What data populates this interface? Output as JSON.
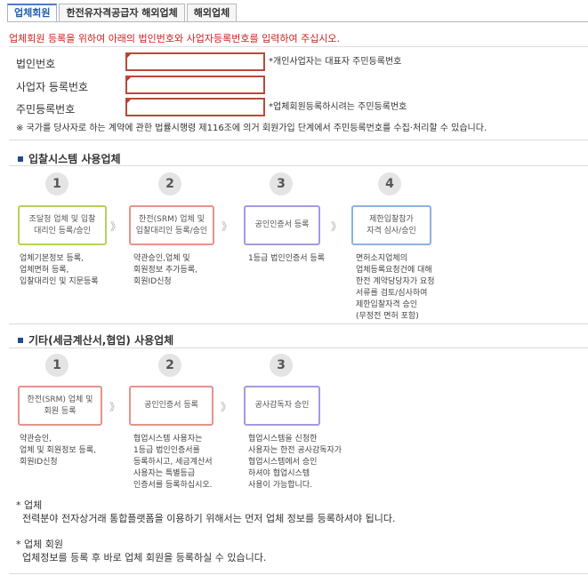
{
  "tabs": [
    {
      "label": "업체회원"
    },
    {
      "label": "한전유자격공급자 해외업체"
    },
    {
      "label": "해외업체"
    }
  ],
  "intro": "업체회원 등록을 위하여 아래의 법인번호와 사업자등록번호를 입력하여 주십시오.",
  "fields": [
    {
      "label": "법인번호",
      "note": "*개인사업자는 대표자 주민등록번호"
    },
    {
      "label": "사업자 등록번호",
      "note": ""
    },
    {
      "label": "주민등록번호",
      "note": "*업체회원등록하시려는 주민등록번호"
    }
  ],
  "notice": "※ 국가를 당사자로 하는 계약에 관한 법률시행령 제116조에 의거 회원가입 단계에서 주민등록번호를 수집·처리할 수 있습니다.",
  "section1": {
    "title": "입찰시스템 사용업체",
    "steps": [
      {
        "num": "1",
        "box": "조달청 업체 및 입찰\n대리인 등록/승인",
        "desc": "업체기본정보 등록,\n업체면허 등록,\n입찰대리인 및 지문등록"
      },
      {
        "num": "2",
        "box": "한전(SRM) 업체 및\n입찰대리인 등록/승인",
        "desc": "약관승인,업체 및\n회원정보 추가등록,\n회원ID신청"
      },
      {
        "num": "3",
        "box": "공인인증서 등록",
        "desc": "1등급 법인인증서 등록"
      },
      {
        "num": "4",
        "box": "제한입찰참가\n자격 심사/승인",
        "desc": "면허소지업체의\n업체등록요청건에 대해\n한전 계약담당자가 요청\n서류를 검토/심사하여\n제한입찰자격 승인\n(무정전 면허 포함)"
      }
    ]
  },
  "section2": {
    "title": "기타(세금계산서,협업) 사용업체",
    "steps": [
      {
        "num": "1",
        "box": "한전(SRM) 업체 및\n회원 등록",
        "desc": "약관승인,\n업체 및 회원정보 등록,\n회원ID신청"
      },
      {
        "num": "2",
        "box": "공인인증서 등록",
        "desc": "협업시스템 사용자는\n1등급 법인인증서를\n등록하시고, 세금계산서\n사용자는 특별등급\n인증서를 등록하십시오."
      },
      {
        "num": "3",
        "box": "공사감독자 승인",
        "desc": "협업시스템을 신청한\n사용자는 한전 공사감독자가\n협업시스템에서 승인\n하셔야 협업시스템\n사용이 가능합니다."
      }
    ]
  },
  "arrow_glyph": "》",
  "footer": [
    {
      "title": "* 업체",
      "text": "전력분야 전자상거래 통합플랫폼을 이용하기 위해서는 먼저 업체 정보를 등록하셔야 됩니다."
    },
    {
      "title": "* 업체 회원",
      "text": "업체정보를 등록 후 바로 업체 회원을 등록하실 수 있습니다."
    }
  ]
}
